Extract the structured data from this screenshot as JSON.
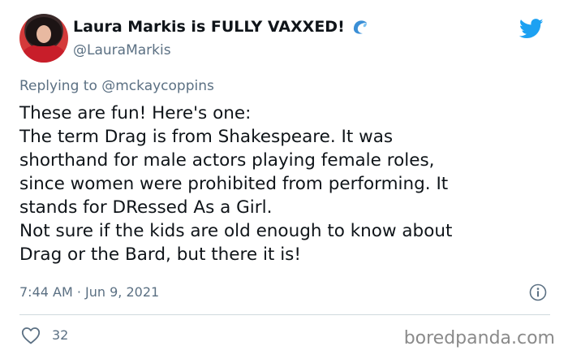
{
  "header": {
    "display_name": "Laura Markis is FULLY VAXXED!",
    "handle": "@LauraMarkis"
  },
  "reply": {
    "prefix": "Replying to ",
    "mention": "@mckaycoppins"
  },
  "tweet": {
    "lines": [
      "These are fun! Here's one:",
      "The term Drag is from Shakespeare. It was",
      "shorthand for male actors playing female roles,",
      "since women were prohibited from performing. It",
      "stands for DRessed As a Girl.",
      "Not sure if the kids are old enough to know about",
      "Drag or the Bard, but there it is!"
    ],
    "time": "7:44 AM",
    "separator": " · ",
    "date": "Jun 9, 2021"
  },
  "engagement": {
    "likes": "32"
  },
  "watermark": "boredpanda.com",
  "colors": {
    "twitter_blue": "#1da1f2",
    "secondary_text": "#5b7083",
    "primary_text": "#0f1419"
  },
  "icons": [
    "wave-icon",
    "twitter-bird-icon",
    "info-icon",
    "heart-icon"
  ]
}
